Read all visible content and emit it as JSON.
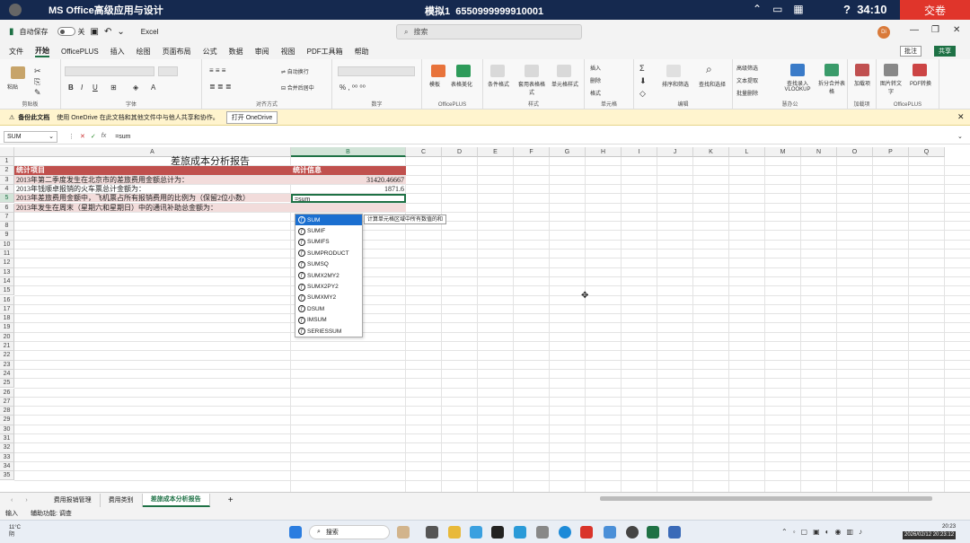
{
  "exam": {
    "app_title": "MS Office高级应用与设计",
    "mock_label": "模拟1",
    "exam_id": "6550999999910001",
    "timer": "34:10",
    "submit_label": "交卷"
  },
  "title_bar": {
    "autosave_label": "自动保存",
    "toggle_state": "关",
    "app_name": "Excel",
    "search_placeholder": "搜索",
    "user_initials": "Di"
  },
  "menu": {
    "tabs": [
      "文件",
      "开始",
      "OfficePLUS",
      "插入",
      "绘图",
      "页面布局",
      "公式",
      "数据",
      "审阅",
      "视图",
      "PDF工具箱",
      "帮助"
    ],
    "active_index": 1,
    "comment_label": "批注",
    "share_label": "共享"
  },
  "ribbon": {
    "groups": [
      "剪贴板",
      "字体",
      "对齐方式",
      "数字",
      "OfficePLUS",
      "样式",
      "单元格",
      "编辑",
      "慧办公",
      "加载项",
      "OfficePLUS"
    ],
    "paste_label": "粘贴",
    "wrap_label": "自动换行",
    "merge_label": "合并后居中",
    "template_label": "模板",
    "beautify_label": "表格美化",
    "cond_format_label": "条件格式",
    "table_format_label": "套用表格格式",
    "cell_style_label": "单元格样式",
    "insert_label": "插入",
    "delete_label": "删除",
    "format_label": "格式",
    "sort_filter_label": "排序和筛选",
    "find_select_label": "查找和选择",
    "adv_filter_label": "高级筛选",
    "text_extract_label": "文本提取",
    "batch_delete_label": "批量删除",
    "vlookup_label": "查找录入VLOOKUP",
    "split_merge_label": "拆分合并表格",
    "addins_label": "加载项",
    "picture_text_label": "图片转文字",
    "pdf_convert_label": "PDF转换"
  },
  "notification": {
    "title": "备份此文档",
    "message": "使用 OneDrive 在此文档和其他文件中与他人共享和协作。",
    "button": "打开 OneDrive"
  },
  "formula_bar": {
    "name_box": "SUM",
    "formula": "=sum"
  },
  "grid": {
    "columns": [
      "A",
      "B",
      "C",
      "D",
      "E",
      "F",
      "G",
      "H",
      "I",
      "J",
      "K",
      "L",
      "M",
      "N",
      "O",
      "P",
      "Q"
    ],
    "rows": [
      "1",
      "2",
      "3",
      "4",
      "5",
      "6",
      "7",
      "8",
      "9",
      "10",
      "11",
      "12",
      "13",
      "14",
      "15",
      "16",
      "17",
      "18",
      "19",
      "20",
      "21",
      "22",
      "23",
      "24",
      "25",
      "26",
      "27",
      "28",
      "29",
      "30",
      "31",
      "32",
      "33",
      "34",
      "35"
    ],
    "selected_col": "B",
    "selected_row": "5",
    "report_title": "差旅成本分析报告",
    "header_a": "统计项目",
    "header_b": "统计信息",
    "r3_a": "2013年第二季度发生在北京市的差旅费用金额总计为：",
    "r3_b": "31420.46667",
    "r4_a": "2013年钱顺卓报销的火车票总计金额为：",
    "r4_b": "1871.6",
    "r5_a": "2013年差旅费用金额中，飞机票占所有报销费用的比例为（保留2位小数）",
    "r5_b": "=sum",
    "r6_a": "2013年发生在周末（星期六和星期日）中的通讯补助总金额为："
  },
  "autocomplete": {
    "items": [
      "SUM",
      "SUMIF",
      "SUMIFS",
      "SUMPRODUCT",
      "SUMSQ",
      "SUMX2MY2",
      "SUMX2PY2",
      "SUMXMY2",
      "DSUM",
      "IMSUM",
      "SERIESSUM"
    ],
    "selected_index": 0,
    "tooltip": "计算单元格区域中所有数值的和"
  },
  "sheets": {
    "tabs": [
      "费用报销管理",
      "费用类别",
      "差旅成本分析报告"
    ],
    "active_index": 2
  },
  "status": {
    "mode": "输入",
    "accessibility": "辅助功能: 调查"
  },
  "taskbar": {
    "temp": "11°C",
    "weather": "阴",
    "search_label": "搜索",
    "time": "20:23",
    "date": "2026/02/12 20:23:12"
  },
  "colors": {
    "exam_bar": "#15294f",
    "submit": "#e0352b",
    "excel_green": "#1e7145",
    "header_row": "#c0504d",
    "band_row": "#f2dcdb"
  }
}
